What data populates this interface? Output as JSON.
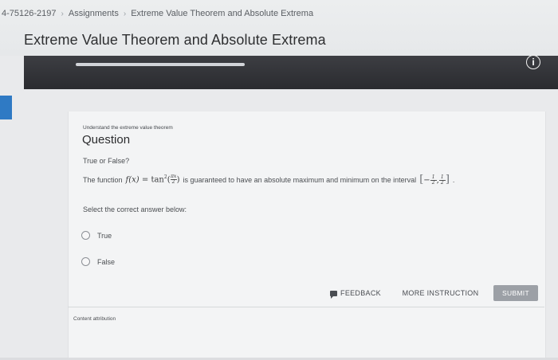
{
  "breadcrumb": {
    "course_id": "4-75126-2197",
    "assignments": "Assignments",
    "current": "Extreme Value Theorem and Absolute Extrema",
    "separator": "›"
  },
  "page_title": "Extreme Value Theorem and Absolute Extrema",
  "progress": {
    "fraction": 0.3
  },
  "info_icon": "i",
  "question": {
    "skill": "Understand the extreme value theorem",
    "heading": "Question",
    "type_label": "True or False?",
    "statement_pre": "The function",
    "function_name": "f(x)",
    "equals": "=",
    "function_body": "tan",
    "exponent": "2",
    "arg_num": "πx",
    "arg_den": "2",
    "statement_mid": "is guaranteed to have an absolute maximum and minimum on the interval",
    "interval_left_num": "1",
    "interval_left_den": "2",
    "interval_right_num": "1",
    "interval_right_den": "2",
    "statement_end": ".",
    "prompt": "Select the correct answer below:",
    "options": [
      "True",
      "False"
    ]
  },
  "buttons": {
    "feedback": "FEEDBACK",
    "more_instruction": "MORE INSTRUCTION",
    "submit": "SUBMIT"
  },
  "content_attribution": "Content attribution",
  "colors": {
    "accent": "#2f7ac4",
    "dark_bar": "#2e2f33",
    "submit_bg": "#9ca0a6"
  },
  "icons": {
    "info": "info-icon",
    "feedback": "feedback-icon",
    "radio": "radio-icon"
  }
}
